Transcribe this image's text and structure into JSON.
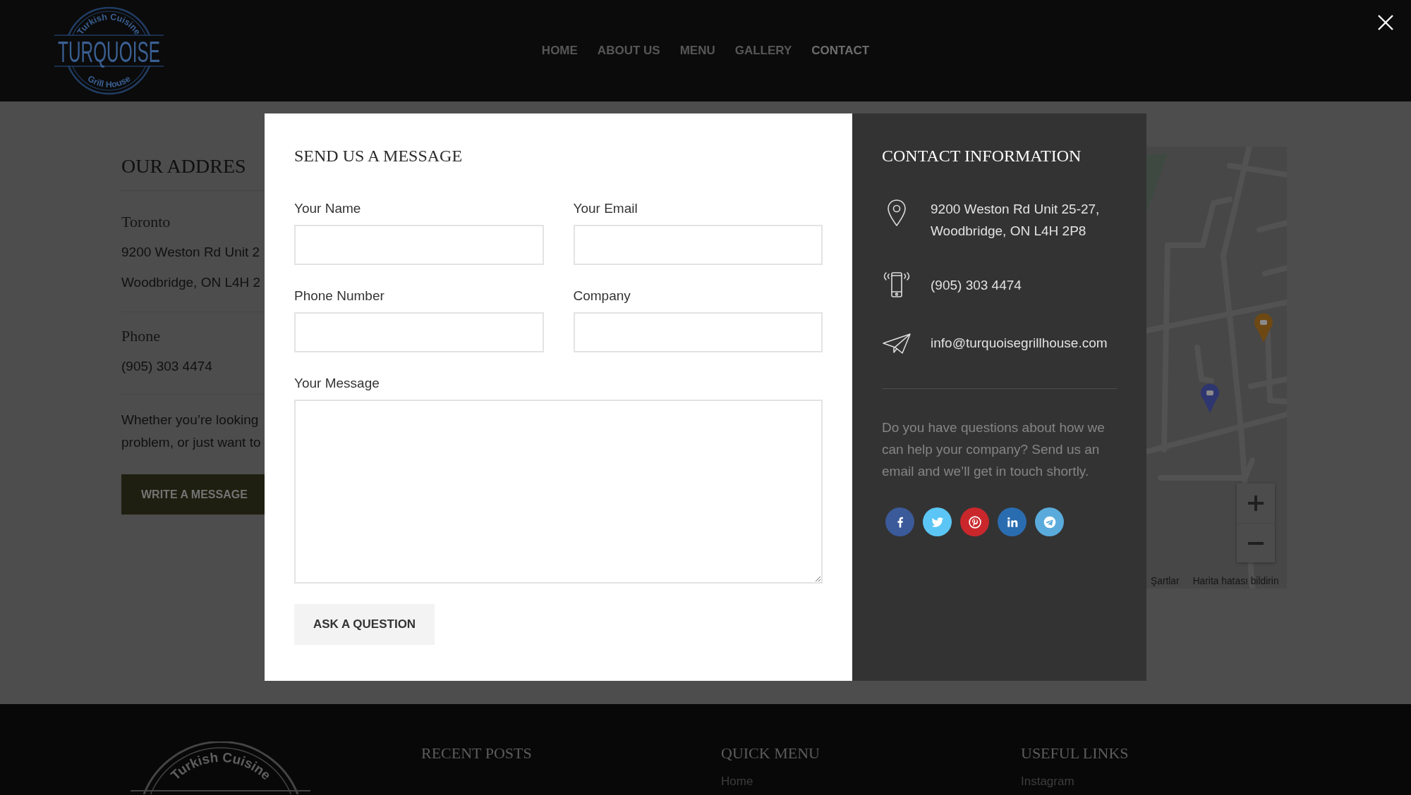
{
  "header": {
    "logo": {
      "arc_top": "Turkish Cuisine",
      "name": "TURQUOISE",
      "arc_bottom": "Grill House"
    },
    "nav": [
      {
        "label": "HOME",
        "selected": false
      },
      {
        "label": "ABOUT US",
        "selected": false
      },
      {
        "label": "MENU",
        "selected": false
      },
      {
        "label": "GALLERY",
        "selected": false
      },
      {
        "label": "CONTACT",
        "selected": true
      }
    ]
  },
  "address_section": {
    "title": "OUR ADDRES",
    "city": "Toronto",
    "address_lines": [
      "9200 Weston Rd Unit 2",
      "Woodbridge, ON L4H 2"
    ],
    "phone_title": "Phone",
    "phone": "(905) 303 4474",
    "text_lines": [
      "Whether you’re looking",
      "problem, or just want to"
    ],
    "button": "WRITE A MESSAGE"
  },
  "map": {
    "links": [
      "Şartlar",
      "Harita hatası bildirin"
    ]
  },
  "modal": {
    "form": {
      "title": "SEND US A MESSAGE",
      "fields": [
        {
          "label": "Your Name",
          "kind": "text"
        },
        {
          "label": "Your Email",
          "kind": "text"
        },
        {
          "label": "Phone Number",
          "kind": "text"
        },
        {
          "label": "Company",
          "kind": "text"
        },
        {
          "label": "Your Message",
          "kind": "textarea"
        }
      ],
      "submit": "ASK A QUESTION"
    },
    "info": {
      "title": "CONTACT INFORMATION",
      "items": [
        {
          "kind": "address",
          "lines": [
            "9200 Weston Rd Unit 25-27,",
            "Woodbridge, ON L4H 2P8"
          ]
        },
        {
          "kind": "phone",
          "lines": [
            "(905) 303 4474"
          ]
        },
        {
          "kind": "email",
          "lines": [
            "info@turquoisegrillhouse.com"
          ]
        }
      ],
      "note": "Do you have questions about how we can help your company? Send us an email and we’ll get in touch shortly.",
      "social": [
        {
          "kind": "facebook",
          "color": "#3b5a9a"
        },
        {
          "kind": "twitter",
          "color": "#5bc6f5"
        },
        {
          "kind": "pinterest",
          "color": "#c9272c"
        },
        {
          "kind": "linkedin",
          "color": "#2a6cb0"
        },
        {
          "kind": "telegram",
          "color": "#5aabdc"
        }
      ]
    }
  },
  "footer": {
    "logo_arc": "Turkish Cuisine",
    "columns": [
      {
        "title": "RECENT POSTS"
      },
      {
        "title": "QUICK MENU",
        "links": [
          "Home"
        ]
      },
      {
        "title": "USEFUL LINKS",
        "links": [
          "Instagram"
        ]
      }
    ]
  }
}
